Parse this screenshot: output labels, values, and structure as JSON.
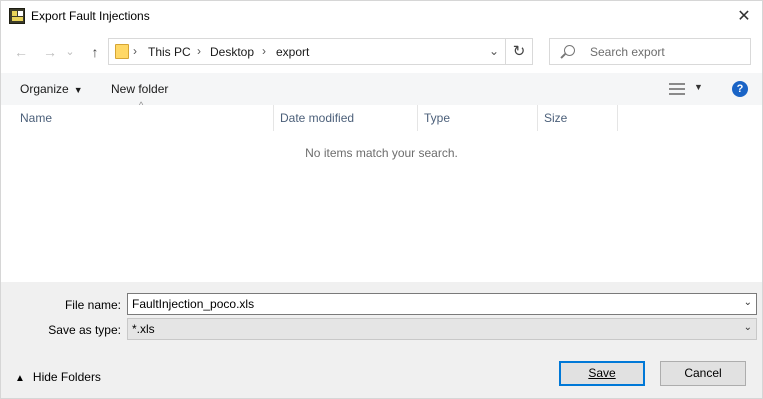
{
  "window": {
    "title": "Export Fault Injections",
    "close": "✕"
  },
  "nav": {
    "back": "←",
    "forward": "→",
    "recent": "⌄",
    "up": "↑"
  },
  "address": {
    "crumbs": [
      "This PC",
      "Desktop",
      "export"
    ],
    "separator": "›",
    "dropdown": "⌄",
    "refresh": "↻"
  },
  "search": {
    "placeholder": "Search export"
  },
  "command_bar": {
    "organize": "Organize",
    "organize_arrow": "▼",
    "new_folder": "New folder",
    "view_arrow": "▼",
    "help": "?"
  },
  "columns": [
    "Name",
    "Date modified",
    "Type",
    "Size"
  ],
  "sort_indicator": "^",
  "empty_message": "No items match your search.",
  "form": {
    "file_name_label": "File name:",
    "file_name_value": "FaultInjection_poco.xls",
    "save_as_type_label": "Save as type:",
    "save_as_type_value": "*.xls",
    "dropdown": "⌄"
  },
  "hide_folders": {
    "arrow": "▲",
    "label": "Hide Folders"
  },
  "buttons": {
    "save": "Save",
    "cancel": "Cancel"
  }
}
